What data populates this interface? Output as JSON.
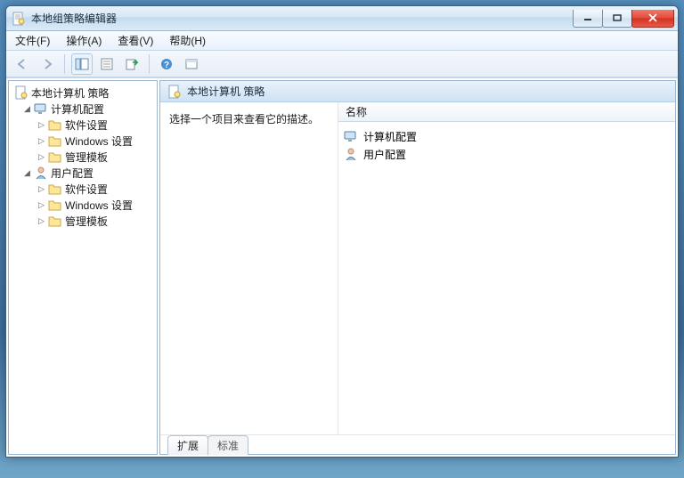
{
  "window": {
    "title": "本地组策略编辑器"
  },
  "menubar": {
    "file": "文件(F)",
    "action": "操作(A)",
    "view": "查看(V)",
    "help": "帮助(H)"
  },
  "tree": {
    "root": "本地计算机 策略",
    "computer": {
      "label": "计算机配置",
      "software": "软件设置",
      "windows": "Windows 设置",
      "templates": "管理模板"
    },
    "user": {
      "label": "用户配置",
      "software": "软件设置",
      "windows": "Windows 设置",
      "templates": "管理模板"
    }
  },
  "right": {
    "header": "本地计算机 策略",
    "description_prompt": "选择一个项目来查看它的描述。",
    "column_name": "名称",
    "items": {
      "computer": "计算机配置",
      "user": "用户配置"
    },
    "tabs": {
      "extended": "扩展",
      "standard": "标准"
    }
  }
}
